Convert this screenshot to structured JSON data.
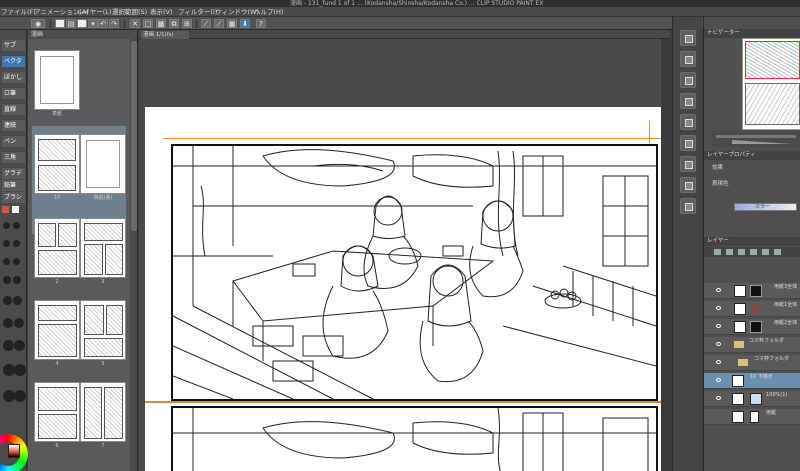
{
  "titlebar": {
    "text": "漫画 - 131_fund 1 of 1 ... (Kodansha/Shinsha/Kodansha Co.) ... CLIP STUDIO PAINT EX"
  },
  "menubar": {
    "items": [
      "ファイル(F)",
      "アニメーション(A)",
      "レイヤー(L)",
      "選択範囲(S)",
      "表示(V)",
      "フィルター(I)",
      "ウィンドウ(W)",
      "ヘルプ(H)"
    ]
  },
  "pagemgr": {
    "tab": "漫画",
    "pages": [
      {
        "label": "表紙"
      },
      {
        "label": "1P"
      },
      {
        "label": "表紙(裏)"
      },
      {
        "label": "2"
      },
      {
        "label": "3"
      },
      {
        "label": "4"
      },
      {
        "label": "5"
      },
      {
        "label": "6"
      },
      {
        "label": "7"
      }
    ]
  },
  "canvas": {
    "tab": "漫画 1/1(fs)"
  },
  "toolstrip": {
    "tools": [
      "サブ",
      "ベクタ",
      "ぼかし",
      "ロ筆",
      "直線",
      "連続",
      "ペン",
      "三角",
      "グラデ",
      "鉛筆",
      "ブラシ"
    ]
  },
  "rightpanels": {
    "navigator_tab": "ナビゲーター",
    "layerprop_tab": "レイヤープロパティ",
    "effect_label": "効果",
    "expression_label": "表現色",
    "expression_value": "カラー",
    "layers_tab": "レイヤー",
    "layers": [
      {
        "name": "用紙3全体"
      },
      {
        "name": "用紙1全体"
      },
      {
        "name": "用紙2全体"
      },
      {
        "name": "コマ枠フォルダ"
      },
      {
        "name": "コマ枠フォルダ"
      },
      {
        "name": "1P 下描き"
      },
      {
        "name": "100%(1)"
      },
      {
        "name": "用紙"
      }
    ]
  }
}
